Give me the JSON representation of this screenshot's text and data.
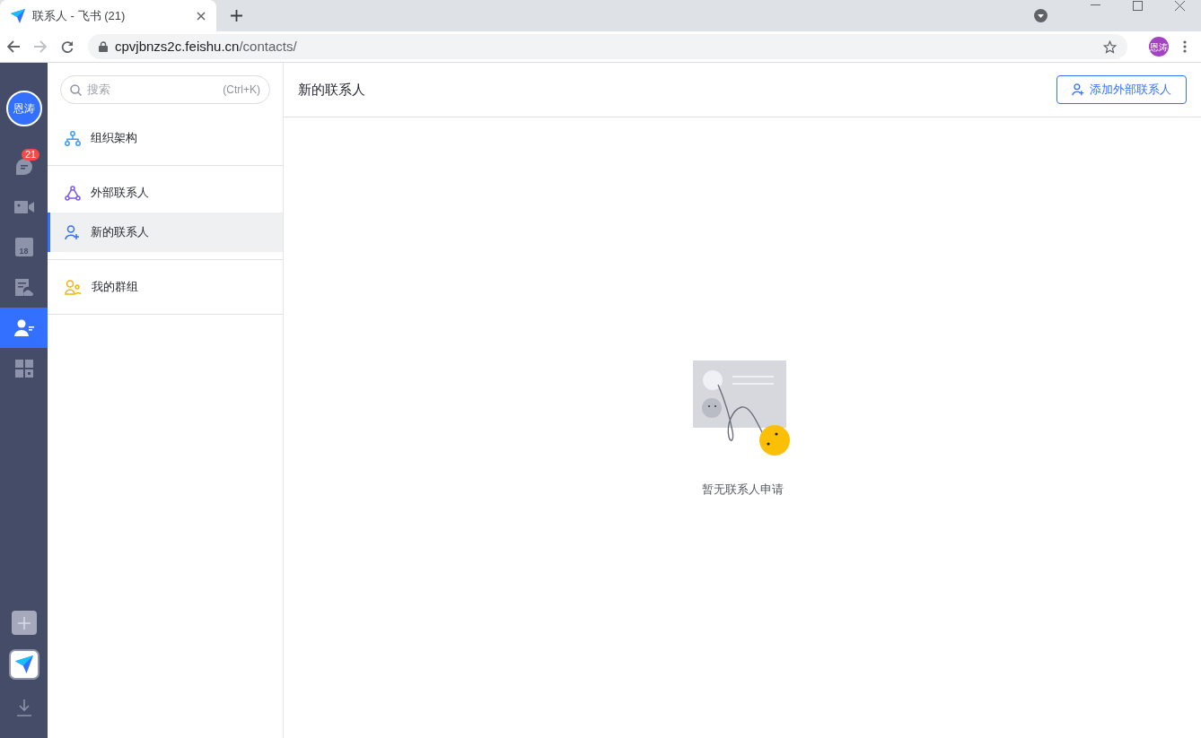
{
  "browser": {
    "tab_title": "联系人 - 飞书 (21)",
    "address_host": "cpvjbnzs2c.feishu.cn",
    "address_path": "/contacts/",
    "profile": "恩涛"
  },
  "rail": {
    "avatar": "恩涛",
    "items": [
      {
        "kind": "chat",
        "badge": "21",
        "selected": false
      },
      {
        "kind": "video",
        "selected": false
      },
      {
        "kind": "calendar",
        "label": "18",
        "selected": false
      },
      {
        "kind": "docs",
        "selected": false
      },
      {
        "kind": "contacts",
        "selected": true
      },
      {
        "kind": "apps",
        "selected": false
      }
    ]
  },
  "sidebar": {
    "search": {
      "placeholder": "搜索",
      "shortcut": "(Ctrl+K)"
    },
    "groups": [
      [
        {
          "kind": "org",
          "label": "组织架构",
          "selected": false
        }
      ],
      [
        {
          "kind": "external",
          "label": "外部联系人",
          "selected": false
        },
        {
          "kind": "new",
          "label": "新的联系人",
          "selected": true
        }
      ],
      [
        {
          "kind": "groups",
          "label": "我的群组",
          "selected": false
        }
      ]
    ]
  },
  "main": {
    "title": "新的联系人",
    "add_button": "添加外部联系人",
    "empty_text": "暂无联系人申请"
  }
}
